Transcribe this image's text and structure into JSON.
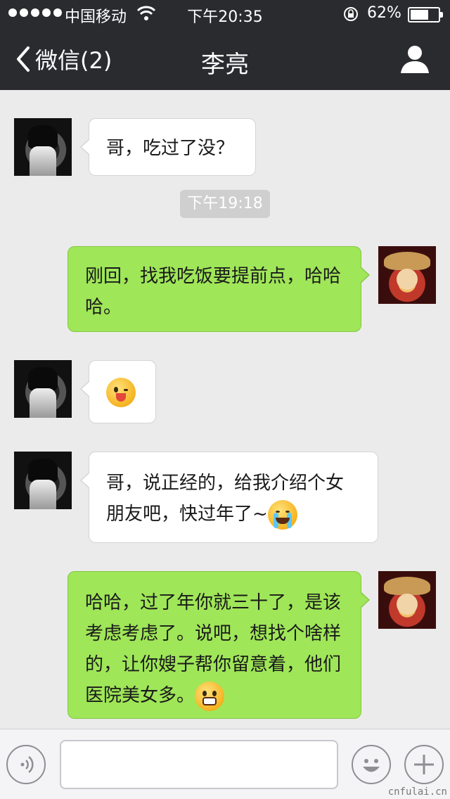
{
  "status_bar": {
    "carrier": "中国移动",
    "time": "下午20:35",
    "battery_text": "62%",
    "battery_level": 0.62,
    "signal_dots": 5
  },
  "nav": {
    "back_label": "微信(2)",
    "title": "李亮"
  },
  "messages": [
    {
      "side": "in",
      "text": "哥，吃过了没？"
    },
    {
      "timestamp": "下午19:18"
    },
    {
      "side": "out",
      "text": "刚回，找我吃饭要提前点，哈哈哈。"
    },
    {
      "side": "in",
      "emoji": "wink-tongue-emoji"
    },
    {
      "side": "in",
      "text": "哥，说正经的，给我介绍个女朋友吧，快过年了~",
      "emoji": "crying-emoji"
    },
    {
      "side": "out",
      "text": "哈哈，过了年你就三十了，是该考虑考虑了。说吧，想找个啥样的，让你嫂子帮你留意着，他们医院美女多。",
      "emoji": "grin-emoji"
    }
  ],
  "input_bar": {
    "input_value": "",
    "voice_icon": "voice-icon",
    "emoji_icon": "smiley-icon",
    "plus_icon": "plus-icon"
  },
  "watermark": "cnfulai.cn",
  "colors": {
    "nav_bg": "#2a2b2f",
    "chat_bg": "#ebebeb",
    "bubble_out": "#9fe658",
    "bubble_in": "#ffffff"
  }
}
